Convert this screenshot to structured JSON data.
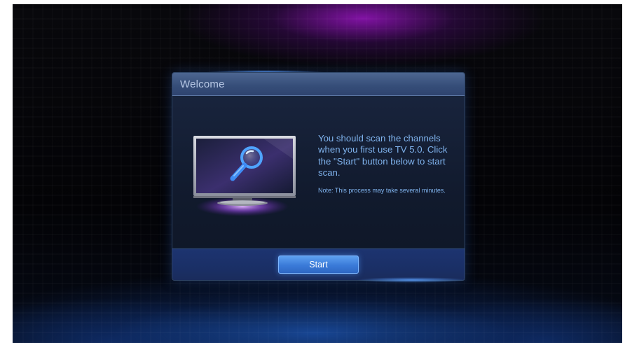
{
  "dialog": {
    "title": "Welcome",
    "message": "You should scan the channels when you first use TV 5.0. Click the \"Start\" button below to start scan.",
    "note": "Note: This process may take several minutes.",
    "start_label": "Start"
  },
  "icons": {
    "illustration": "tv-with-magnifier-icon"
  },
  "colors": {
    "title_bar": "#3d5782",
    "message_text": "#7fb2ec",
    "button": "#3a7ad8",
    "footer": "#1c3168"
  }
}
